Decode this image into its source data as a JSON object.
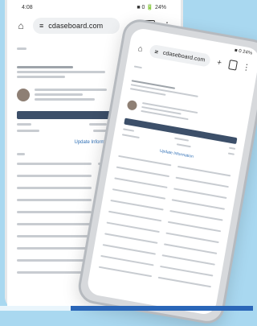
{
  "back_phone": {
    "status": {
      "time": "4:08",
      "signal": "■ 0 🔋 24%"
    },
    "url": "cdaseboard.com",
    "buttons": {
      "home": "⌂",
      "new_tab": "+",
      "tabs": "□",
      "menu": "⋮"
    },
    "link_text": "Update Information"
  },
  "front_phone": {
    "status": {
      "time": "",
      "signal": "■ 0 24%"
    },
    "url": "cdaseboard.com",
    "buttons": {
      "home": "⌂",
      "new_tab": "+",
      "tabs": "□",
      "menu": "⋮"
    },
    "link_text": "Update Information"
  },
  "colors": {
    "background": "#a9d8f0",
    "table_header": "#3c4f69",
    "link": "#2f6fb5",
    "accent_bar": "#2a66b8"
  }
}
